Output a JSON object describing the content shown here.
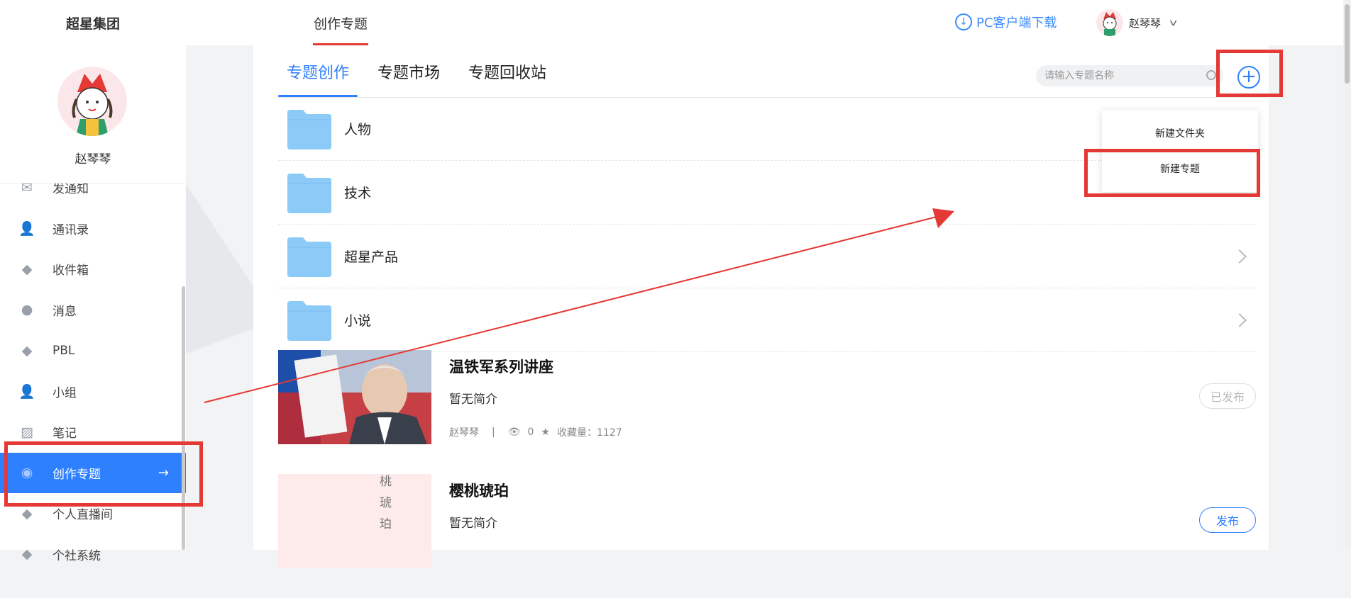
{
  "header": {
    "org_name": "超星集团",
    "top_tab": "创作专题",
    "download_label": "PC客户端下载",
    "user_name": "赵琴琴"
  },
  "sidebar": {
    "user_name": "赵琴琴",
    "items": [
      {
        "label": "发通知",
        "icon": "envelope-icon"
      },
      {
        "label": "通讯录",
        "icon": "contacts-icon"
      },
      {
        "label": "收件箱",
        "icon": "inbox-icon"
      },
      {
        "label": "消息",
        "icon": "chat-bubble-icon"
      },
      {
        "label": "PBL",
        "icon": "pbl-icon"
      },
      {
        "label": "小组",
        "icon": "group-icon"
      },
      {
        "label": "笔记",
        "icon": "note-icon"
      },
      {
        "label": "创作专题",
        "icon": "topic-icon",
        "active": true
      },
      {
        "label": "个人直播间",
        "icon": "live-icon"
      },
      {
        "label": "个社系统",
        "icon": "system-icon"
      }
    ]
  },
  "main": {
    "tabs": [
      {
        "label": "专题创作",
        "active": true
      },
      {
        "label": "专题市场"
      },
      {
        "label": "专题回收站"
      }
    ],
    "search_placeholder": "请输入专题名称",
    "folders": [
      {
        "name": "人物"
      },
      {
        "name": "技术"
      },
      {
        "name": "超星产品"
      },
      {
        "name": "小说"
      }
    ],
    "topics": [
      {
        "title": "温铁军系列讲座",
        "desc": "暂无简介",
        "author": "赵琴琴",
        "views": "0",
        "favorites": "收藏量：1127",
        "status": "已发布"
      },
      {
        "title": "樱桃琥珀",
        "desc": "暂无简介",
        "status": "发布",
        "cover_text": "桃\n琥\n珀"
      }
    ]
  },
  "dropdown": {
    "items": [
      "新建文件夹",
      "新建专题"
    ]
  },
  "colors": {
    "accent": "#2f80ff",
    "annotation": "#e53935",
    "folder": "#8ccaf7"
  }
}
